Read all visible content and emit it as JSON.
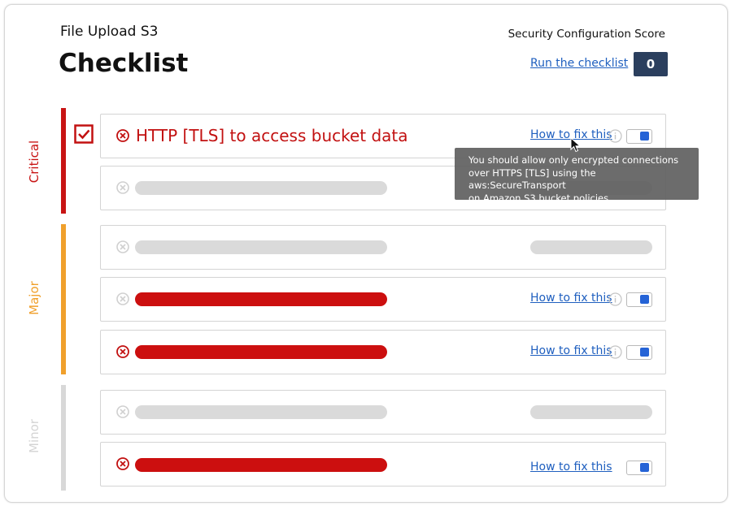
{
  "header": {
    "app_title": "File Upload S3",
    "page_title": "Checklist",
    "score_label": "Security Configuration Score",
    "run_link": "Run the checklist",
    "score_value": "0"
  },
  "categories": [
    {
      "label": "Critical",
      "color": "#c81414"
    },
    {
      "label": "Major",
      "color": "#f0a02c"
    },
    {
      "label": "Minor",
      "color": "#d8d8d8"
    }
  ],
  "rows": {
    "critical_1": {
      "title": "HTTP [TLS] to access bucket data",
      "fix_link": "How to fix this",
      "checked": true,
      "toggle_on": true
    },
    "major_2": {
      "fix_link": "How to fix this",
      "toggle_on": true
    },
    "major_3": {
      "fix_link": "How to fix this",
      "toggle_on": true
    },
    "minor_2": {
      "fix_link": "How to fix this",
      "toggle_on": true
    }
  },
  "tooltip": {
    "line1": "You should allow only encrypted connections",
    "line2": "over HTTPS [TLS] using the aws:SecureTransport",
    "line3": "on Amazon S3 bucket policies."
  },
  "icons": {
    "fail": "x-circle-icon",
    "info": "info-icon",
    "checkbox": "checkbox-checked-icon",
    "cursor": "mouse-cursor-icon"
  },
  "colors": {
    "accent_red": "#cc0f0f",
    "link_blue": "#1f5fbf",
    "score_badge": "#2b3f5e",
    "toggle_blue": "#2563d6"
  }
}
